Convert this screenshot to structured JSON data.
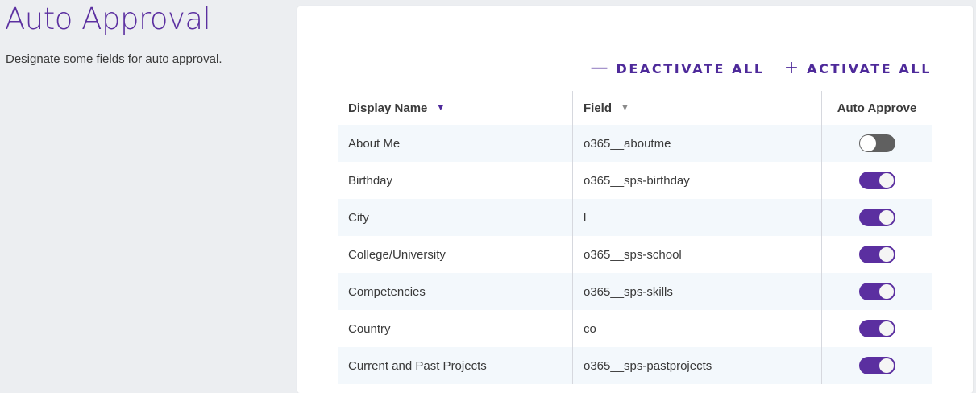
{
  "page": {
    "title": "Auto Approval",
    "description": "Designate some fields for auto approval."
  },
  "actions": {
    "deactivate_label": "DEACTIVATE ALL",
    "deactivate_icon": "minus-icon",
    "activate_label": "ACTIVATE ALL",
    "activate_icon": "plus-icon",
    "accent_color": "#4e2a9a"
  },
  "table": {
    "columns": [
      {
        "label": "Display Name",
        "sort": "descending-active"
      },
      {
        "label": "Field",
        "sort": "inactive"
      },
      {
        "label": "Auto Approve"
      }
    ],
    "rows": [
      {
        "display_name": "About Me",
        "field": "o365__aboutme",
        "auto_approve": false
      },
      {
        "display_name": "Birthday",
        "field": "o365__sps-birthday",
        "auto_approve": true
      },
      {
        "display_name": "City",
        "field": "l",
        "auto_approve": true
      },
      {
        "display_name": "College/University",
        "field": "o365__sps-school",
        "auto_approve": true
      },
      {
        "display_name": "Competencies",
        "field": "o365__sps-skills",
        "auto_approve": true
      },
      {
        "display_name": "Country",
        "field": "co",
        "auto_approve": true
      },
      {
        "display_name": "Current and Past Projects",
        "field": "o365__sps-pastprojects",
        "auto_approve": true
      }
    ]
  },
  "colors": {
    "title": "#5b2fa0",
    "toggle_on": "#5b2fa0",
    "toggle_off": "#606060",
    "row_stripe": "#f3f8fc",
    "page_bg": "#eceef1"
  }
}
